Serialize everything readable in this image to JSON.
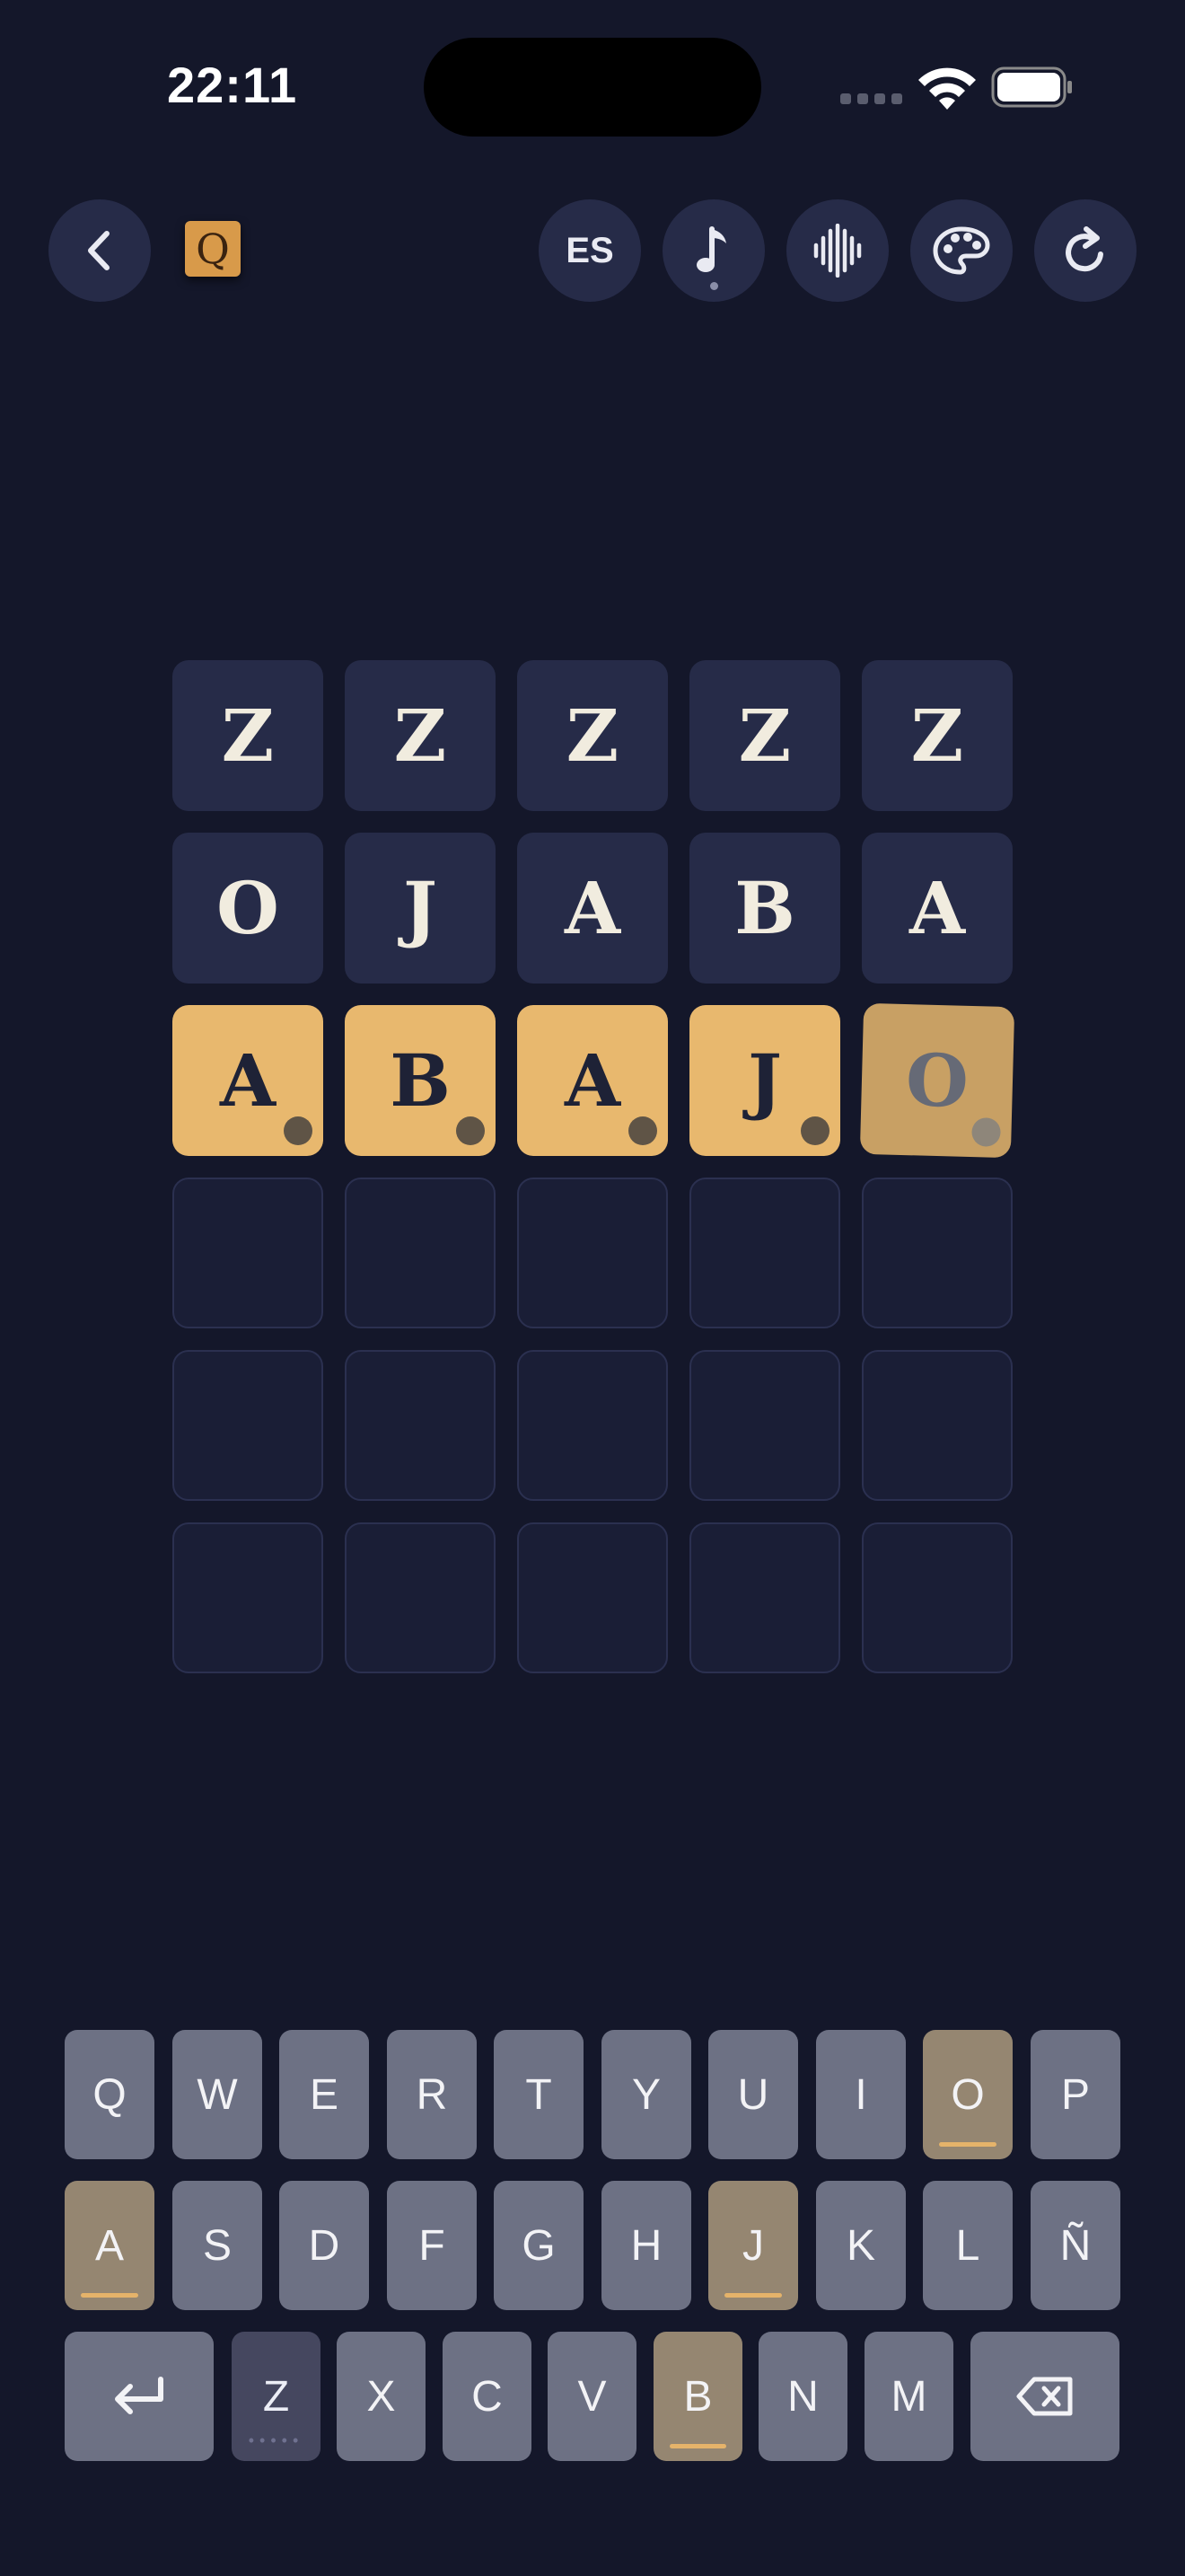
{
  "status_bar": {
    "time": "22:11"
  },
  "header": {
    "back_icon": "chevron-left-icon",
    "logo_letter": "Q",
    "language_label": "ES",
    "buttons": [
      "music-note-icon",
      "waveform-icon",
      "palette-icon",
      "refresh-icon"
    ]
  },
  "board": {
    "rows": [
      {
        "state": "submitted",
        "letters": [
          "Z",
          "Z",
          "Z",
          "Z",
          "Z"
        ]
      },
      {
        "state": "submitted",
        "letters": [
          "O",
          "J",
          "A",
          "B",
          "A"
        ]
      },
      {
        "state": "current",
        "letters": [
          "A",
          "B",
          "A",
          "J",
          "O"
        ]
      },
      {
        "state": "empty",
        "letters": [
          "",
          "",
          "",
          "",
          ""
        ]
      },
      {
        "state": "empty",
        "letters": [
          "",
          "",
          "",
          "",
          ""
        ]
      },
      {
        "state": "empty",
        "letters": [
          "",
          "",
          "",
          "",
          ""
        ]
      }
    ]
  },
  "keyboard": {
    "row1": [
      "Q",
      "W",
      "E",
      "R",
      "T",
      "Y",
      "U",
      "I",
      "O",
      "P"
    ],
    "row2": [
      "A",
      "S",
      "D",
      "F",
      "G",
      "H",
      "J",
      "K",
      "L",
      "Ñ"
    ],
    "row3": [
      "Z",
      "X",
      "C",
      "V",
      "B",
      "N",
      "M"
    ],
    "enter_icon": "return-icon",
    "delete_icon": "backspace-icon",
    "present_keys": [
      "O",
      "A",
      "J",
      "B"
    ],
    "absent_keys": [
      "Z"
    ]
  },
  "colors": {
    "background": "#14172a",
    "tile_filled": "#262b48",
    "tile_gold": "#e8b86e",
    "key_default": "#6d7184",
    "key_present": "#958671",
    "present_underline": "#e5b36a"
  }
}
